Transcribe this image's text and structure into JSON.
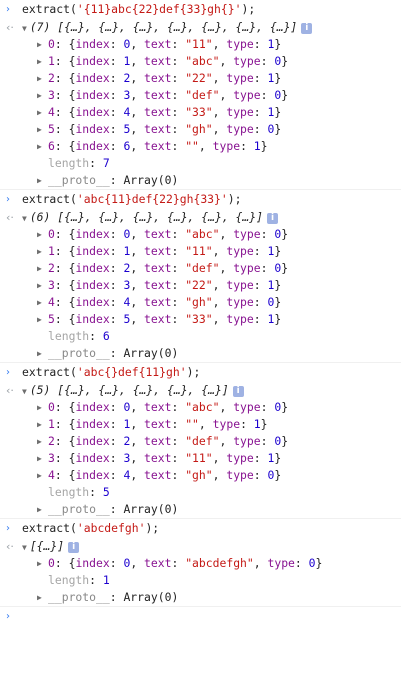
{
  "console": {
    "prompt_glyph": "›",
    "result_glyph": "‹·",
    "info_badge": "i",
    "entries": [
      {
        "input": {
          "fn": "extract(",
          "arg": "'{11}abc{22}def{33}gh{}'",
          "end": ");"
        },
        "summary": "(7) [{…}, {…}, {…}, {…}, {…}, {…}, {…}]",
        "items": [
          {
            "idx": "0",
            "index": "0",
            "text": "\"11\"",
            "type": "1"
          },
          {
            "idx": "1",
            "index": "1",
            "text": "\"abc\"",
            "type": "0"
          },
          {
            "idx": "2",
            "index": "2",
            "text": "\"22\"",
            "type": "1"
          },
          {
            "idx": "3",
            "index": "3",
            "text": "\"def\"",
            "type": "0"
          },
          {
            "idx": "4",
            "index": "4",
            "text": "\"33\"",
            "type": "1"
          },
          {
            "idx": "5",
            "index": "5",
            "text": "\"gh\"",
            "type": "0"
          },
          {
            "idx": "6",
            "index": "6",
            "text": "\"\"",
            "type": "1"
          }
        ],
        "length": "7"
      },
      {
        "input": {
          "fn": "extract(",
          "arg": "'abc{11}def{22}gh{33}'",
          "end": ");"
        },
        "summary": "(6) [{…}, {…}, {…}, {…}, {…}, {…}]",
        "items": [
          {
            "idx": "0",
            "index": "0",
            "text": "\"abc\"",
            "type": "0"
          },
          {
            "idx": "1",
            "index": "1",
            "text": "\"11\"",
            "type": "1"
          },
          {
            "idx": "2",
            "index": "2",
            "text": "\"def\"",
            "type": "0"
          },
          {
            "idx": "3",
            "index": "3",
            "text": "\"22\"",
            "type": "1"
          },
          {
            "idx": "4",
            "index": "4",
            "text": "\"gh\"",
            "type": "0"
          },
          {
            "idx": "5",
            "index": "5",
            "text": "\"33\"",
            "type": "1"
          }
        ],
        "length": "6"
      },
      {
        "input": {
          "fn": "extract(",
          "arg": "'abc{}def{11}gh'",
          "end": ");"
        },
        "summary": "(5) [{…}, {…}, {…}, {…}, {…}]",
        "items": [
          {
            "idx": "0",
            "index": "0",
            "text": "\"abc\"",
            "type": "0"
          },
          {
            "idx": "1",
            "index": "1",
            "text": "\"\"",
            "type": "1"
          },
          {
            "idx": "2",
            "index": "2",
            "text": "\"def\"",
            "type": "0"
          },
          {
            "idx": "3",
            "index": "3",
            "text": "\"11\"",
            "type": "1"
          },
          {
            "idx": "4",
            "index": "4",
            "text": "\"gh\"",
            "type": "0"
          }
        ],
        "length": "5"
      },
      {
        "input": {
          "fn": "extract(",
          "arg": "'abcdefgh'",
          "end": ");"
        },
        "summary": "[{…}]",
        "items": [
          {
            "idx": "0",
            "index": "0",
            "text": "\"abcdefgh\"",
            "type": "0"
          }
        ],
        "length": "1"
      }
    ],
    "labels": {
      "length_key": "length",
      "proto_key": "__proto__",
      "proto_value": "Array(0)",
      "index_key": "index",
      "text_key": "text",
      "type_key": "type"
    }
  }
}
